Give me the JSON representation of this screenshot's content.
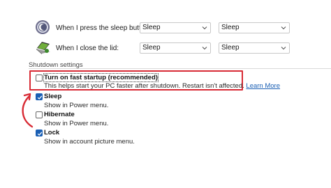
{
  "power_rows": [
    {
      "label": "When I press the sleep button:",
      "icon": "sleep-button-icon",
      "on_battery": "Sleep",
      "plugged_in": "Sleep"
    },
    {
      "label": "When I close the lid:",
      "icon": "laptop-lid-icon",
      "on_battery": "Sleep",
      "plugged_in": "Sleep"
    }
  ],
  "shutdown": {
    "title": "Shutdown settings",
    "options": [
      {
        "title": "Turn on fast startup (recommended)",
        "desc": "This helps start your PC faster after shutdown. Restart isn't affected.",
        "link": "Learn More",
        "checked": false
      },
      {
        "title": "Sleep",
        "desc": "Show in Power menu.",
        "checked": true
      },
      {
        "title": "Hibernate",
        "desc": "Show in Power menu.",
        "checked": false
      },
      {
        "title": "Lock",
        "desc": "Show in account picture menu.",
        "checked": true
      }
    ]
  },
  "colors": {
    "accent": "#1a5fb4",
    "highlight": "#d82a34"
  }
}
